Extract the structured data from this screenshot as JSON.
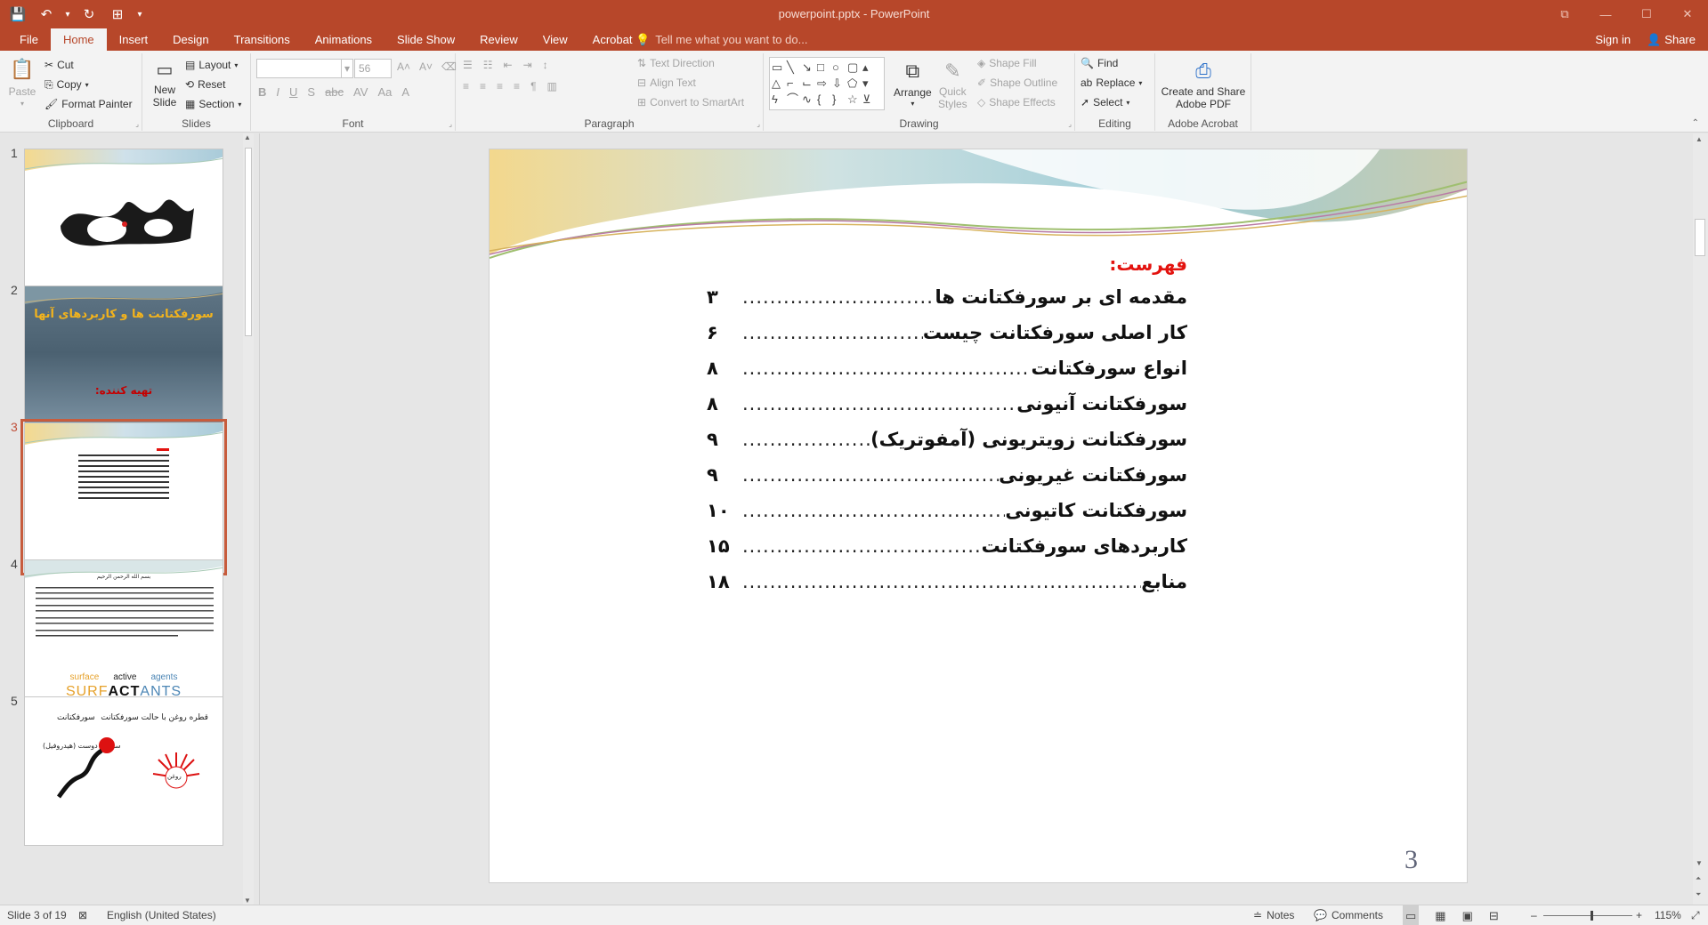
{
  "window": {
    "title": "powerpoint.pptx - PowerPoint",
    "controls": {
      "restore_ribbon": "⧉",
      "minimize": "—",
      "maximize": "☐",
      "close": "✕"
    }
  },
  "qat": {
    "save": "💾",
    "undo": "↶",
    "undo_more": "▾",
    "redo": "↻",
    "start_from_beginning": "⊞",
    "customize": "▾"
  },
  "tabs": [
    "File",
    "Home",
    "Insert",
    "Design",
    "Transitions",
    "Animations",
    "Slide Show",
    "Review",
    "View",
    "Acrobat"
  ],
  "active_tab": "Home",
  "tell_me": "Tell me what you want to do...",
  "account": {
    "sign_in": "Sign in",
    "share": "Share"
  },
  "ribbon": {
    "clipboard": {
      "label": "Clipboard",
      "paste": "Paste",
      "cut": "Cut",
      "copy": "Copy",
      "format_painter": "Format Painter"
    },
    "slides": {
      "label": "Slides",
      "new_slide": "New",
      "new_slide_2": "Slide",
      "layout": "Layout",
      "reset": "Reset",
      "section": "Section"
    },
    "font": {
      "label": "Font",
      "font_name": "",
      "font_size": "56"
    },
    "paragraph": {
      "label": "Paragraph",
      "text_direction": "Text Direction",
      "align_text": "Align Text",
      "convert_smartart": "Convert to SmartArt"
    },
    "drawing": {
      "label": "Drawing",
      "arrange": "Arrange",
      "quick_styles": "Quick",
      "quick_styles_2": "Styles",
      "shape_fill": "Shape Fill",
      "shape_outline": "Shape Outline",
      "shape_effects": "Shape Effects"
    },
    "editing": {
      "label": "Editing",
      "find": "Find",
      "replace": "Replace",
      "select": "Select"
    },
    "acrobat": {
      "label": "Adobe Acrobat",
      "create_share": "Create and Share",
      "create_share_2": "Adobe PDF"
    }
  },
  "thumbnails": {
    "numbers": [
      "1",
      "2",
      "3",
      "4",
      "5"
    ],
    "slide2_title": "سورفکتانت ها و کاربردهای آنها",
    "slide2_author": "تهیه کننده:",
    "slide4_header": "بسم الله الرحمن الرحیم",
    "slide4_logo_words": [
      "surface",
      "active",
      "agents"
    ],
    "slide4_logo": [
      "SURF",
      "ACT",
      "ANTS"
    ],
    "slide5_labels": [
      "سورفکتانت",
      "قطره روغن با حالت سورفکتانت",
      "سر آب دوست (هیدروفیل)",
      "روغن"
    ]
  },
  "slide": {
    "toc_title": "فهرست:",
    "entries": [
      {
        "title": "مقدمه ای بر سورفکتانت ها",
        "page": "۳"
      },
      {
        "title": "کار اصلی سورفکتانت چیست ",
        "page": "۶"
      },
      {
        "title": "انواع سورفکتانت ",
        "page": "۸"
      },
      {
        "title": "سورفکتانت آنیونی ",
        "page": "۸"
      },
      {
        "title": "سورفکتانت زویتریونی (آمفوتریک)",
        "page": "۹"
      },
      {
        "title": "سورفکتانت غیریونی ",
        "page": "۹"
      },
      {
        "title": "سورفکتانت کاتیونی ",
        "page": "۱۰"
      },
      {
        "title": "کاربردهای سورفکتانت ",
        "page": "۱۵"
      },
      {
        "title": "منابع ",
        "page": "۱۸"
      }
    ],
    "slide_number": "3"
  },
  "status": {
    "slide_info": "Slide 3 of 19",
    "language": "English (United States)",
    "notes": "Notes",
    "comments": "Comments",
    "zoom": "115%",
    "zoom_level_fraction": 0.55
  },
  "colors": {
    "accent": "#b7472a",
    "toc_title": "#e3130f",
    "selected_thumb": "#c75c3d"
  }
}
